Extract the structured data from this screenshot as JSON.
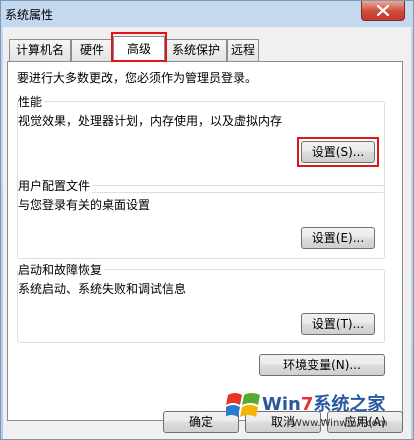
{
  "window": {
    "title": "系统属性"
  },
  "tabs": [
    {
      "label": "计算机名"
    },
    {
      "label": "硬件"
    },
    {
      "label": "高级",
      "active": true
    },
    {
      "label": "系统保护"
    },
    {
      "label": "远程"
    }
  ],
  "panel": {
    "admin_note": "要进行大多数更改，您必须作为管理员登录。",
    "performance": {
      "title": "性能",
      "description": "视觉效果，处理器计划，内存使用，以及虚拟内存",
      "button": "设置(S)..."
    },
    "user_profiles": {
      "title": "用户配置文件",
      "description": "与您登录有关的桌面设置",
      "button": "设置(E)..."
    },
    "startup_recovery": {
      "title": "启动和故障恢复",
      "description": "系统启动、系统失败和调试信息",
      "button": "设置(T)..."
    },
    "env_button": "环境变量(N)..."
  },
  "footer": {
    "ok": "确定",
    "cancel": "取消",
    "apply": "应用(A)"
  },
  "watermark": {
    "brand_prefix": "Win",
    "brand_seven": "7",
    "brand_suffix": "系统之家",
    "url": "Www.Winwin7.com"
  },
  "colors": {
    "highlight": "#e0141a",
    "close_button": "#cf4b3a",
    "window_frame": "#b5cde7"
  }
}
